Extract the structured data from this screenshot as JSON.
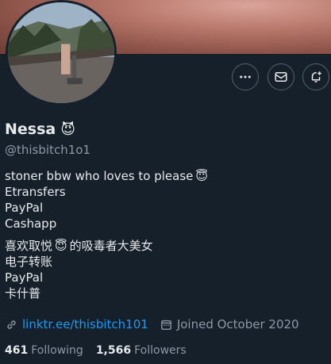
{
  "profile": {
    "name": "Nessa",
    "name_emoji": "😈",
    "handle": "@thisbitch1o1"
  },
  "bio": {
    "lines": [
      {
        "text": "stoner bbw who loves to please",
        "emoji": "😇"
      },
      {
        "text": "Etransfers"
      },
      {
        "text": "PayPal"
      },
      {
        "text": "Cashapp"
      }
    ],
    "lines_cn": [
      {
        "before": "喜欢取悦",
        "emoji": "😇",
        "after": "的吸毒者大美女"
      },
      {
        "text": "电子转账"
      },
      {
        "text": "PayPal"
      },
      {
        "text": "卡什普"
      }
    ]
  },
  "meta": {
    "link": "linktr.ee/thisbitch101",
    "joined": "Joined October 2020"
  },
  "stats": {
    "following_count": "461",
    "following_label": "Following",
    "followers_count": "1,566",
    "followers_label": "Followers"
  },
  "icons": {
    "more": "more-icon",
    "message": "envelope-icon",
    "notify": "bell-plus-icon",
    "link": "link-icon",
    "calendar": "calendar-icon"
  },
  "colors": {
    "background": "#15202b",
    "accent": "#1d9bf0",
    "secondary_text": "#8b98a5",
    "primary_text": "#e7e9ea"
  }
}
